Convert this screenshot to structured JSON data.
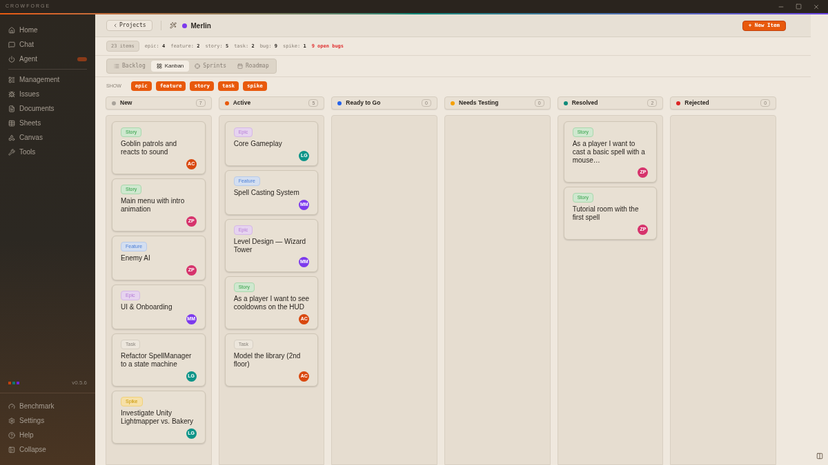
{
  "app_title": "CROWFORGE",
  "sidebar": {
    "items": [
      {
        "label": "Home",
        "selected": false
      },
      {
        "label": "Chat",
        "selected": false
      },
      {
        "label": "Agent",
        "selected": false,
        "badge": true
      },
      {
        "label": "Management",
        "selected": false,
        "divider_before": true
      },
      {
        "label": "Issues",
        "selected": false
      },
      {
        "label": "Documents",
        "selected": false
      },
      {
        "label": "Sheets",
        "selected": false
      },
      {
        "label": "Canvas",
        "selected": false
      },
      {
        "label": "Tools",
        "selected": false
      }
    ],
    "version": "v0.5.6",
    "footer_items": [
      {
        "label": "Benchmark"
      },
      {
        "label": "Settings"
      },
      {
        "label": "Help"
      },
      {
        "label": "Collapse"
      }
    ]
  },
  "header": {
    "back_label": "Projects",
    "project_name": "Merlin",
    "new_button": "+ New Item"
  },
  "stats": {
    "total": "23 items",
    "counts": [
      {
        "label": "epic:",
        "value": "4"
      },
      {
        "label": "feature:",
        "value": "2"
      },
      {
        "label": "story:",
        "value": "5"
      },
      {
        "label": "task:",
        "value": "2"
      },
      {
        "label": "bug:",
        "value": "9"
      },
      {
        "label": "spike:",
        "value": "1"
      }
    ],
    "alert": "9 open bugs"
  },
  "tabs": [
    {
      "label": "Backlog",
      "selected": false
    },
    {
      "label": "Kanban",
      "selected": true
    },
    {
      "label": "Sprints",
      "selected": false
    },
    {
      "label": "Roadmap",
      "selected": false
    }
  ],
  "filter": {
    "label": "SHOW",
    "chips": [
      {
        "label": "epic",
        "selected": true
      },
      {
        "label": "feature",
        "selected": true
      },
      {
        "label": "story",
        "selected": true
      },
      {
        "label": "task",
        "selected": true
      },
      {
        "label": "spike",
        "selected": true
      }
    ]
  },
  "columns": [
    {
      "name": "New",
      "color": "#a8a29a",
      "count": "7",
      "cards": [
        {
          "kind": "story",
          "tag": "Story",
          "title": "Goblin patrols and reacts to sound",
          "assignee": "AC",
          "color": "#d9480f"
        },
        {
          "kind": "story",
          "tag": "Story",
          "title": "Main menu with intro animation",
          "assignee": "ZP",
          "color": "#d6336c"
        },
        {
          "kind": "feature",
          "tag": "Feature",
          "title": "Enemy AI",
          "assignee": "ZP",
          "color": "#d6336c"
        },
        {
          "kind": "epic",
          "tag": "Epic",
          "title": "UI & Onboarding",
          "assignee": "MM",
          "color": "#7c3aed"
        },
        {
          "kind": "task",
          "tag": "Task",
          "title": "Refactor SpellManager to a state machine",
          "assignee": "LG",
          "color": "#0d9488"
        },
        {
          "kind": "spike",
          "tag": "Spike",
          "title": "Investigate Unity Lightmapper vs. Bakery",
          "assignee": "LG",
          "color": "#0d9488"
        }
      ]
    },
    {
      "name": "Active",
      "color": "#e8590c",
      "count": "5",
      "cards": [
        {
          "kind": "epic",
          "tag": "Epic",
          "title": "Core Gameplay",
          "assignee": "LG",
          "color": "#0d9488"
        },
        {
          "kind": "feature",
          "tag": "Feature",
          "title": "Spell Casting System",
          "assignee": "MM",
          "color": "#7c3aed"
        },
        {
          "kind": "epic",
          "tag": "Epic",
          "title": "Level Design — Wizard Tower",
          "assignee": "MM",
          "color": "#7c3aed"
        },
        {
          "kind": "story",
          "tag": "Story",
          "title": "As a player I want to see cooldowns on the HUD",
          "assignee": "AC",
          "color": "#d9480f"
        },
        {
          "kind": "task",
          "tag": "Task",
          "title": "Model the library (2nd floor)",
          "assignee": "AC",
          "color": "#d9480f"
        }
      ]
    },
    {
      "name": "Ready to Go",
      "color": "#2563eb",
      "count": "0"
    },
    {
      "name": "Needs Testing",
      "color": "#f59f00",
      "count": "0"
    },
    {
      "name": "Resolved",
      "color": "#0f8a7a",
      "count": "2",
      "cards": [
        {
          "kind": "story",
          "tag": "Story",
          "title": "As a player I want to cast a basic spell with a mouse…",
          "assignee": "ZP",
          "color": "#d6336c"
        },
        {
          "kind": "story",
          "tag": "Story",
          "title": "Tutorial room with the first spell",
          "assignee": "ZP",
          "color": "#d6336c"
        }
      ]
    },
    {
      "name": "Rejected",
      "color": "#dc2626",
      "count": "0"
    }
  ]
}
